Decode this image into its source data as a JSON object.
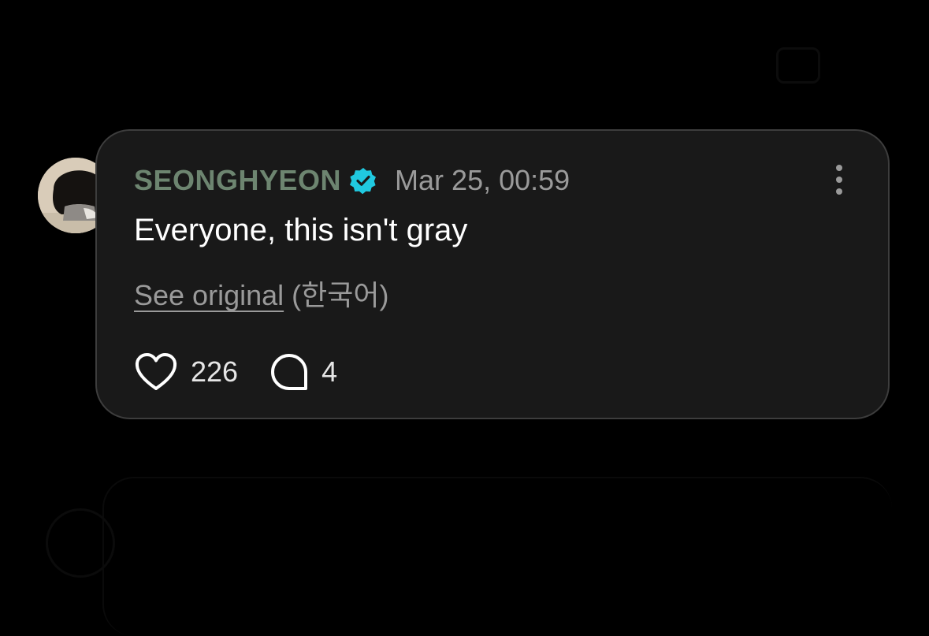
{
  "comment": {
    "username": "SEONGHYEON",
    "timestamp": "Mar 25, 00:59",
    "text": "Everyone, this isn't gray",
    "see_original_label": "See original",
    "original_language": "(한국어)",
    "like_count": "226",
    "reply_count": "4"
  },
  "icons": {
    "verified": "verified-badge-icon",
    "more": "more-vertical-icon",
    "like": "heart-icon",
    "reply": "speech-bubble-icon"
  },
  "colors": {
    "background": "#000000",
    "card": "#191919",
    "card_border": "#3d3d3d",
    "username": "#6d8570",
    "verified_badge": "#20c9e0",
    "muted_text": "#9a9a9a",
    "primary_text": "#ffffff"
  }
}
